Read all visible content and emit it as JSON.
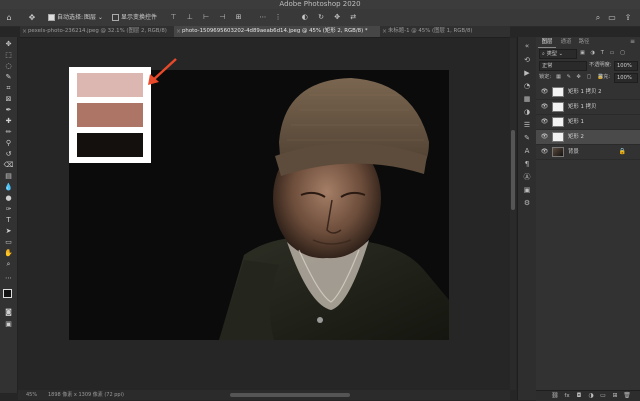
{
  "app": {
    "title": "Adobe Photoshop 2020"
  },
  "options_bar": {
    "auto_select_label": "自动选择:",
    "layer_select_value": "图层",
    "transform_controls_label": "显示变换控件",
    "icons": [
      "move-tool-icon",
      "align-icons",
      "3d-mode-icons",
      "search-icon",
      "workspace-icon",
      "share-icon"
    ]
  },
  "tabs": [
    {
      "label": "pexels-photo-236214.jpeg @ 32.1% (图层 2, RGB/8)",
      "active": false
    },
    {
      "label": "photo-1509695603202-4d89aeab6d14.jpeg @ 45% (矩形 2, RGB/8) *",
      "active": true
    },
    {
      "label": "未标题-1 @ 45% (图层 1, RGB/8)",
      "active": false
    }
  ],
  "swatch_colors": [
    "#dcb7b1",
    "#ac7566",
    "#14100e"
  ],
  "annotation_color": "#e8492a",
  "status_bar": {
    "zoom": "45%",
    "doc_info": "1898 像素 x 1309 像素 (72 ppi)"
  },
  "layers_panel": {
    "tabs": [
      "图层",
      "通道",
      "路径"
    ],
    "kind_filter": "类型",
    "blend_mode": "正常",
    "opacity_label": "不透明度:",
    "opacity_value": "100%",
    "lock_label": "锁定:",
    "fill_label": "填充:",
    "fill_value": "100%",
    "layers": [
      {
        "name": "矩形 1 拷贝 2",
        "selected": false,
        "type": "shape"
      },
      {
        "name": "矩形 1 拷贝",
        "selected": false,
        "type": "shape"
      },
      {
        "name": "矩形 1",
        "selected": false,
        "type": "shape"
      },
      {
        "name": "矩形 2",
        "selected": true,
        "type": "shape"
      },
      {
        "name": "背景",
        "selected": false,
        "type": "image",
        "locked": true
      }
    ],
    "footer_icons": [
      "link-icon",
      "fx-icon",
      "mask-icon",
      "adjustment-icon",
      "group-icon",
      "new-layer-icon",
      "trash-icon"
    ]
  }
}
